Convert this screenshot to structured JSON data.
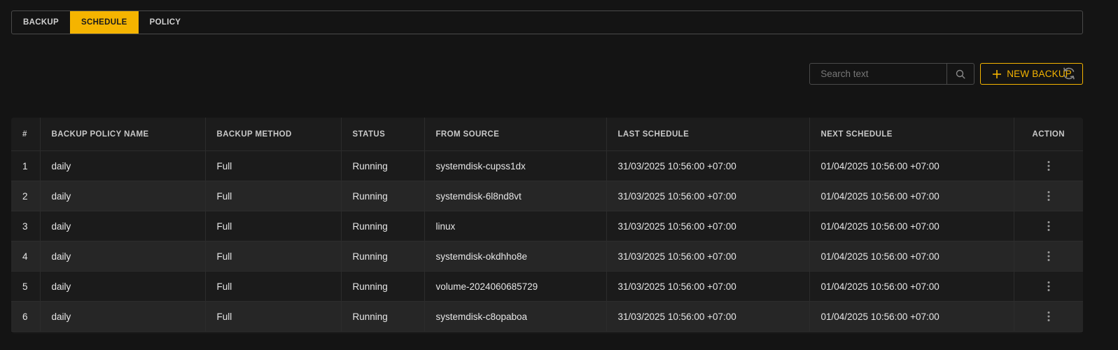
{
  "tabs": [
    {
      "label": "BACKUP",
      "active": false
    },
    {
      "label": "SCHEDULE",
      "active": true
    },
    {
      "label": "POLICY",
      "active": false
    }
  ],
  "toolbar": {
    "search_placeholder": "Search text",
    "search_value": "",
    "new_backup_label": "NEW BACKUP"
  },
  "table": {
    "columns": [
      "#",
      "BACKUP POLICY NAME",
      "BACKUP METHOD",
      "STATUS",
      "FROM SOURCE",
      "LAST SCHEDULE",
      "NEXT SCHEDULE",
      "ACTION"
    ],
    "rows": [
      {
        "num": "1",
        "policy": "daily",
        "method": "Full",
        "status": "Running",
        "source": "systemdisk-cupss1dx",
        "last": "31/03/2025 10:56:00 +07:00",
        "next": "01/04/2025 10:56:00 +07:00"
      },
      {
        "num": "2",
        "policy": "daily",
        "method": "Full",
        "status": "Running",
        "source": "systemdisk-6l8nd8vt",
        "last": "31/03/2025 10:56:00 +07:00",
        "next": "01/04/2025 10:56:00 +07:00"
      },
      {
        "num": "3",
        "policy": "daily",
        "method": "Full",
        "status": "Running",
        "source": "linux",
        "last": "31/03/2025 10:56:00 +07:00",
        "next": "01/04/2025 10:56:00 +07:00"
      },
      {
        "num": "4",
        "policy": "daily",
        "method": "Full",
        "status": "Running",
        "source": "systemdisk-okdhho8e",
        "last": "31/03/2025 10:56:00 +07:00",
        "next": "01/04/2025 10:56:00 +07:00"
      },
      {
        "num": "5",
        "policy": "daily",
        "method": "Full",
        "status": "Running",
        "source": "volume-2024060685729",
        "last": "31/03/2025 10:56:00 +07:00",
        "next": "01/04/2025 10:56:00 +07:00"
      },
      {
        "num": "6",
        "policy": "daily",
        "method": "Full",
        "status": "Running",
        "source": "systemdisk-c8opaboa",
        "last": "31/03/2025 10:56:00 +07:00",
        "next": "01/04/2025 10:56:00 +07:00"
      }
    ]
  },
  "icons": {
    "search": "search-icon",
    "plus": "plus-icon",
    "refresh": "refresh-icon",
    "row_action": "kebab-menu-icon"
  },
  "colors": {
    "accent": "#f5b400",
    "background": "#141414",
    "table_bg": "#1c1c1c",
    "row_alt": "#262626"
  }
}
